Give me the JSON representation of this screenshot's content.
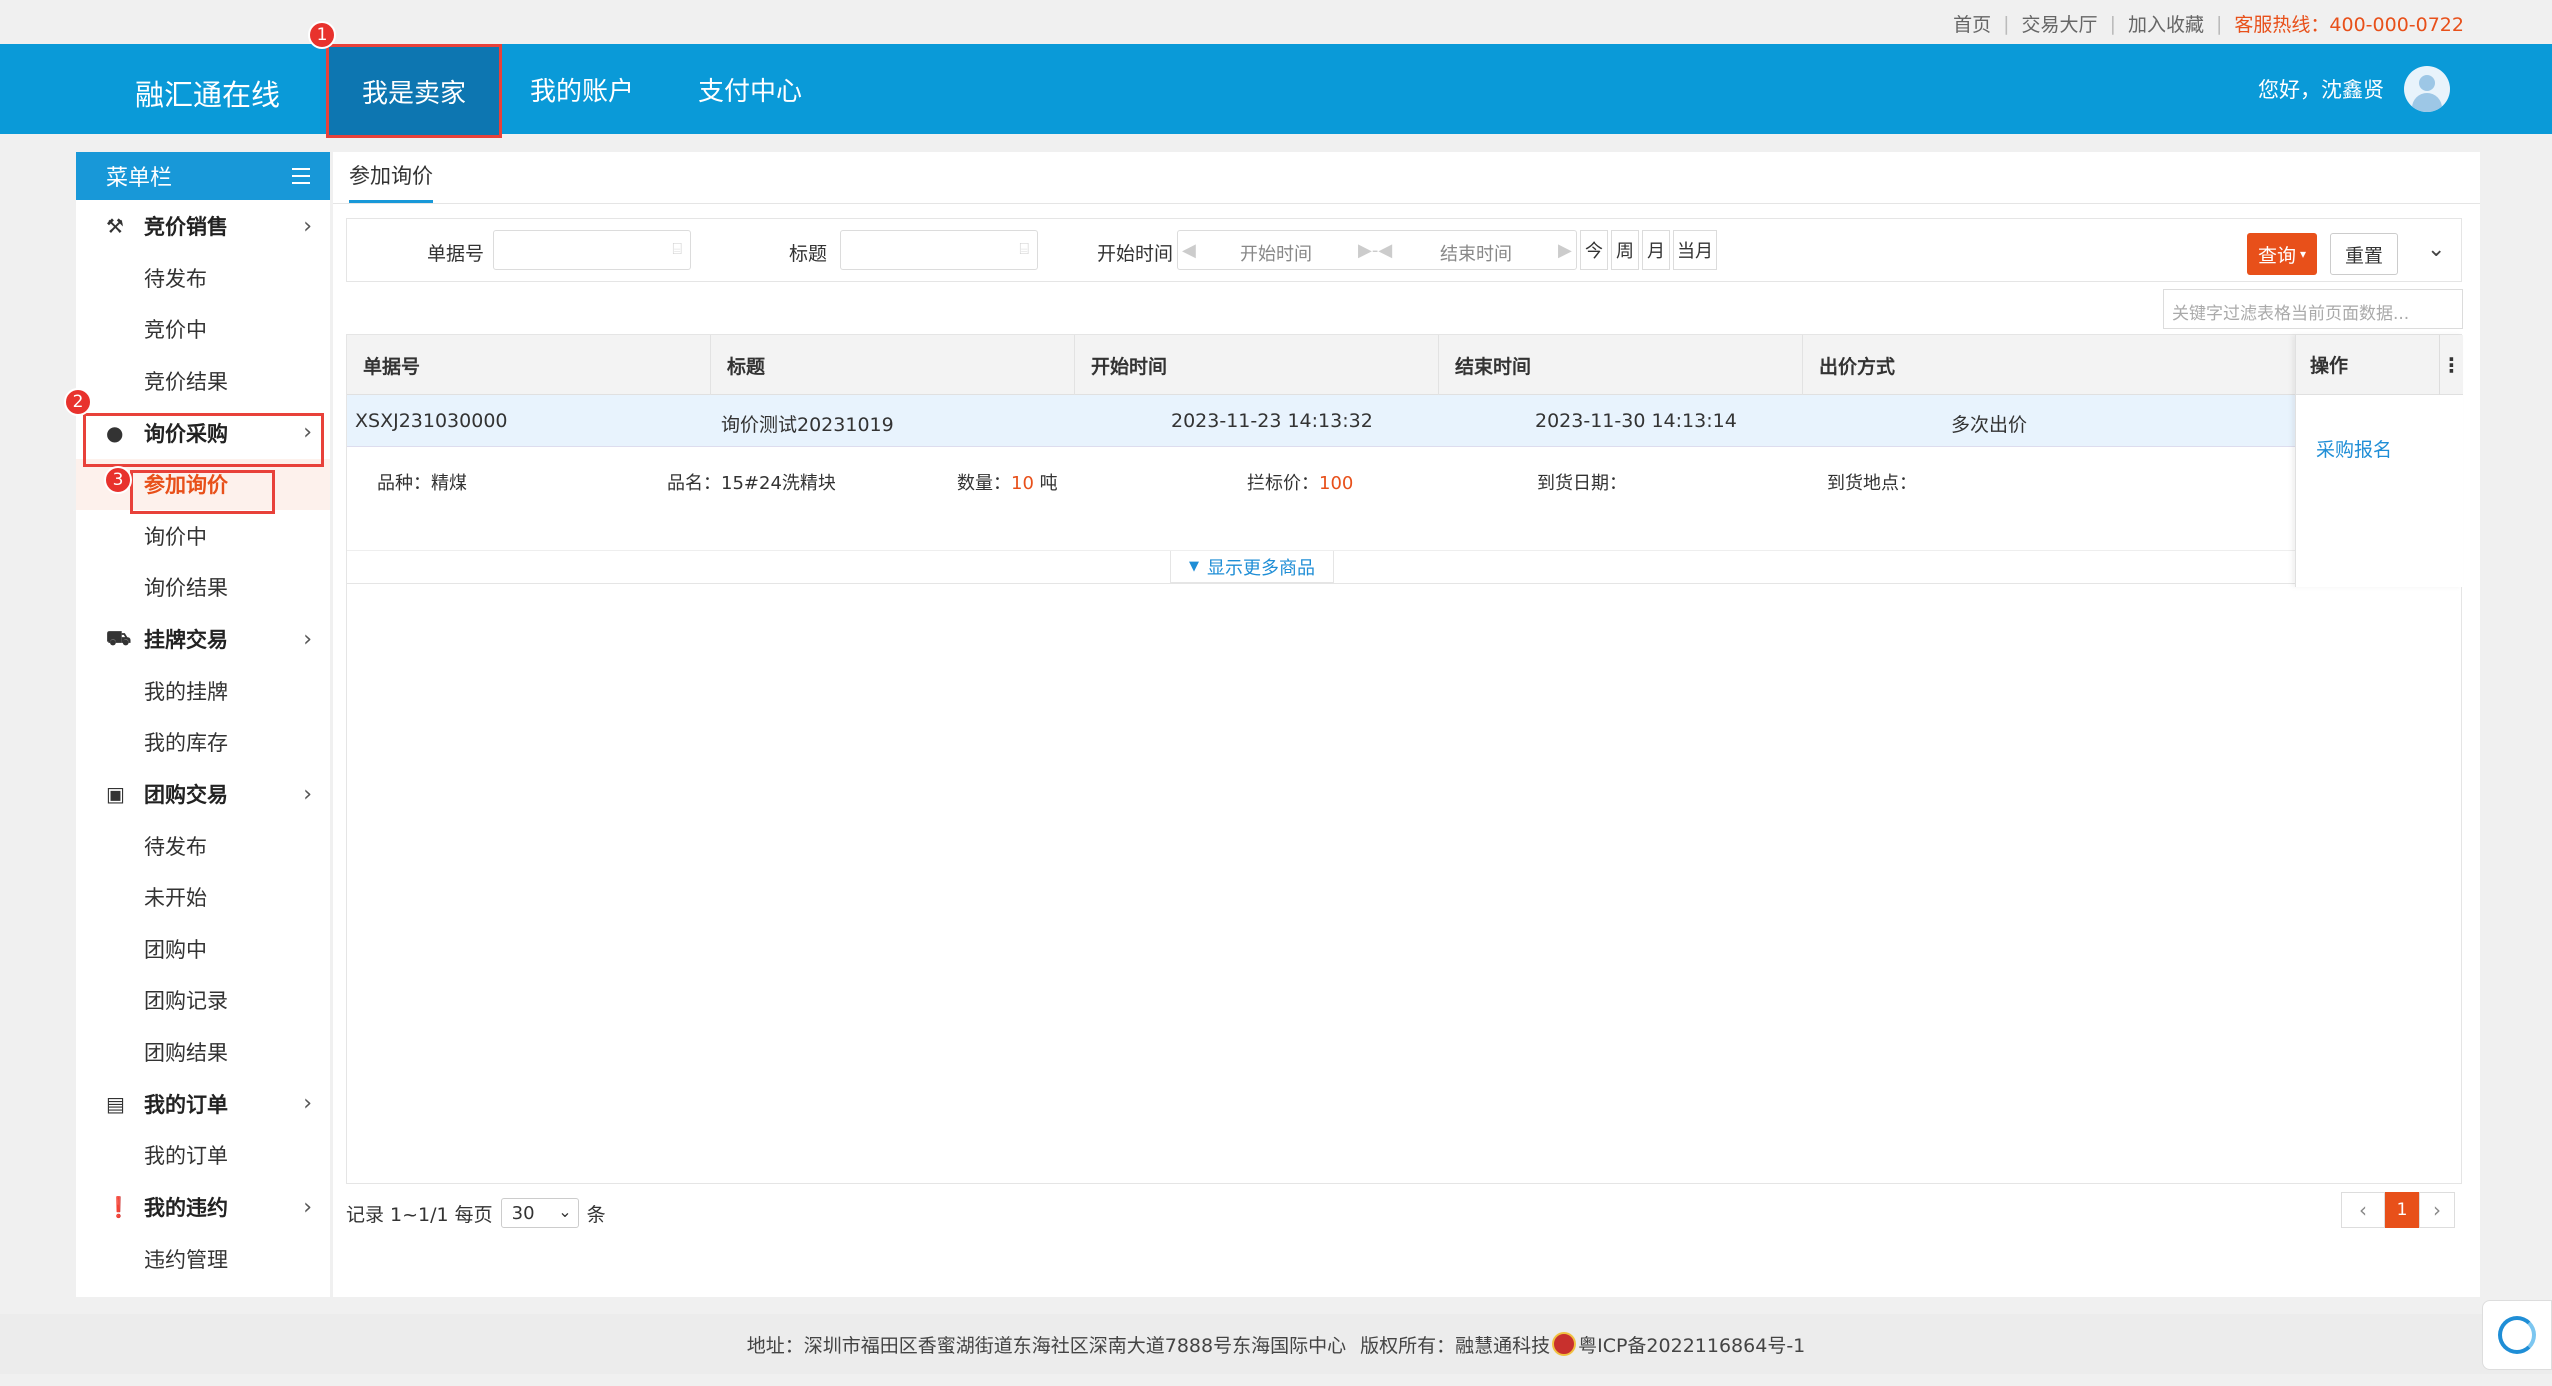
{
  "topbar": {
    "links": [
      "首页",
      "交易大厅",
      "加入收藏"
    ],
    "hotline": "客服热线：400-000-0722"
  },
  "header": {
    "logo": "融汇通在线",
    "nav": [
      "我是卖家",
      "我的账户",
      "支付中心"
    ],
    "greeting": "您好，沈鑫贤"
  },
  "steps": [
    "1",
    "2",
    "3"
  ],
  "sidebar": {
    "title": "菜单栏",
    "groups": [
      {
        "label": "竞价销售",
        "icon": "gavel-icon",
        "items": [
          "待发布",
          "竞价中",
          "竞价结果"
        ]
      },
      {
        "label": "询价采购",
        "icon": "check-circle-icon",
        "items": [
          "参加询价",
          "询价中",
          "询价结果"
        ]
      },
      {
        "label": "挂牌交易",
        "icon": "truck-icon",
        "items": [
          "我的挂牌",
          "我的库存"
        ]
      },
      {
        "label": "团购交易",
        "icon": "bag-icon",
        "items": [
          "待发布",
          "未开始",
          "团购中",
          "团购记录",
          "团购结果"
        ]
      },
      {
        "label": "我的订单",
        "icon": "document-icon",
        "items": [
          "我的订单"
        ]
      },
      {
        "label": "我的违约",
        "icon": "alert-icon",
        "items": [
          "违约管理"
        ]
      }
    ]
  },
  "main": {
    "tab": "参加询价",
    "filter": {
      "order_label": "单据号",
      "title_label": "标题",
      "time_label": "开始时间",
      "start_placeholder": "开始时间",
      "end_placeholder": "结束时间",
      "quick": [
        "今",
        "周",
        "月",
        "当月"
      ],
      "query": "查询",
      "reset": "重置"
    },
    "keyword_placeholder": "关键字过滤表格当前页面数据...",
    "table": {
      "headers": [
        "单据号",
        "标题",
        "开始时间",
        "结束时间",
        "出价方式"
      ],
      "op_header": "操作",
      "row": {
        "order": "XSXJ231030000",
        "title": "询价测试20231019",
        "start": "2023-11-23 14:13:32",
        "end": "2023-11-30 14:13:14",
        "bid_mode": "多次出价"
      },
      "detail": {
        "kind_label": "品种：",
        "kind": "精煤",
        "name_label": "品名：",
        "name": "15#24洗精块",
        "qty_label": "数量：",
        "qty": "10",
        "qty_unit": "吨",
        "price_label": "拦标价：",
        "price": "100",
        "date_label": "到货日期：",
        "place_label": "到货地点："
      },
      "show_more": "显示更多商品",
      "op_link": "采购报名"
    },
    "pager": {
      "info": "记录 1~1/1 每页",
      "page_size": "30",
      "unit": "条",
      "current": "1"
    }
  },
  "footer": {
    "address": "地址：深圳市福田区香蜜湖街道东海社区深南大道7888号东海国际中心",
    "copyright": "版权所有：融慧通科技",
    "icp": "粤ICP备2022116864号-1"
  },
  "colors": {
    "header": "#0a9ad8",
    "accent": "#e8501a",
    "link": "#1f8ed6",
    "marker": "#e8322d"
  }
}
